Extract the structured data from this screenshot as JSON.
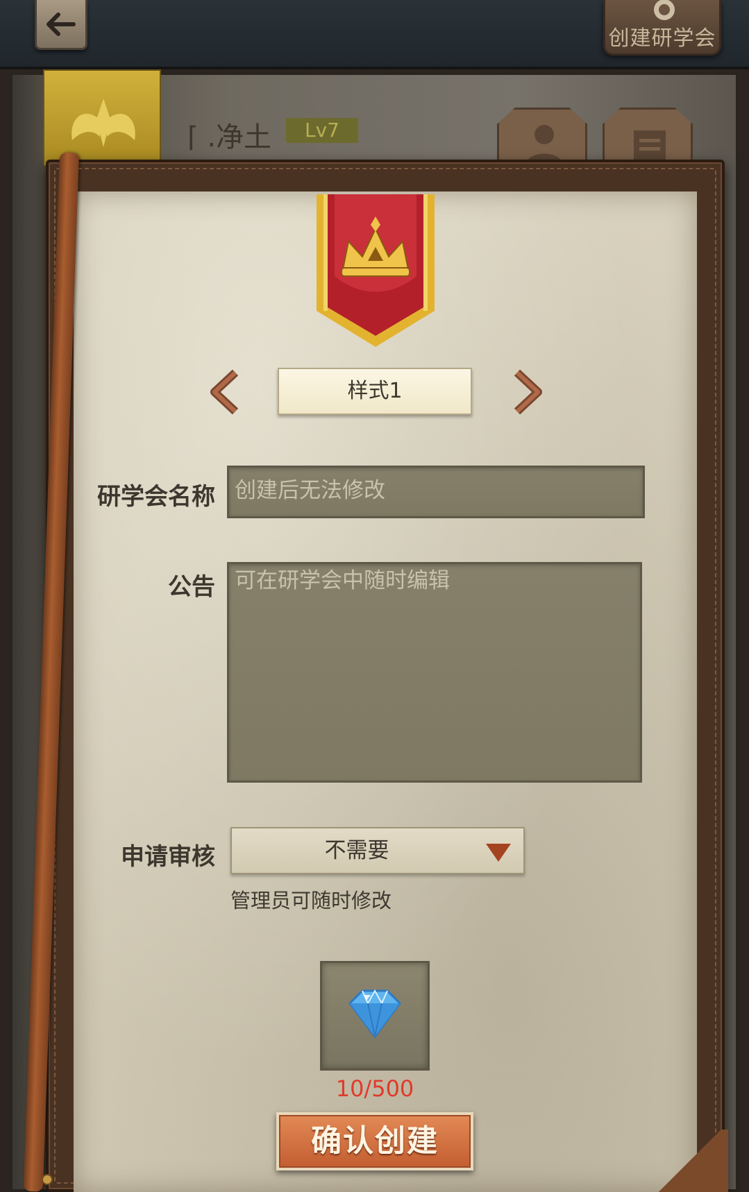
{
  "topbar": {
    "back_icon": "back-arrow-icon",
    "create_label": "创建研学会",
    "create_icon": "crest-icon"
  },
  "guild": {
    "name": "⌈ .净土",
    "level": "Lv7",
    "flag_icon": "winged-emblem-icon",
    "member_icon": "person-icon",
    "info_icon": "document-icon"
  },
  "emblem": {
    "banner_icon": "crown-banner-icon",
    "colors": {
      "banner_red": "#b3202a",
      "banner_gold": "#e3b330"
    }
  },
  "style_selector": {
    "prev_icon": "chevron-left-icon",
    "next_icon": "chevron-right-icon",
    "value": "样式1"
  },
  "form": {
    "name_label": "研学会名称",
    "name_placeholder": "创建后无法修改",
    "notice_label": "公告",
    "notice_placeholder": "可在研学会中随时编辑",
    "review_label": "申请审核",
    "review_value": "不需要",
    "review_hint": "管理员可随时修改"
  },
  "cost": {
    "icon": "diamond-icon",
    "text": "10/500",
    "color": "#e03a2c"
  },
  "confirm_label": "确认创建"
}
